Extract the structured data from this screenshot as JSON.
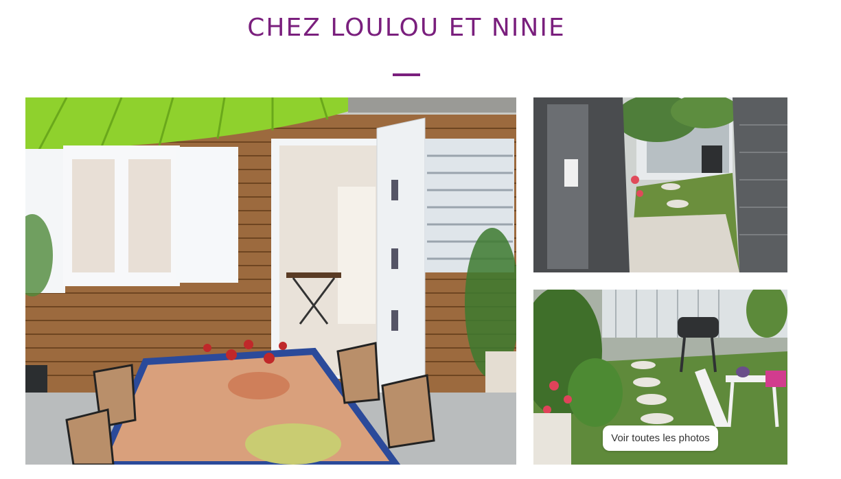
{
  "page": {
    "title": "CHEZ LOULOU ET NINIE"
  },
  "gallery": {
    "see_all_label": "Voir toutes les photos",
    "photos": [
      {
        "subject": "wooden cabin terrace with open door, mosaic table and chairs"
      },
      {
        "subject": "view through open door to garden path and barbecue"
      },
      {
        "subject": "garden with stepping stones, barbecue and white folding table"
      }
    ]
  },
  "colors": {
    "accent": "#7a1f7d"
  }
}
